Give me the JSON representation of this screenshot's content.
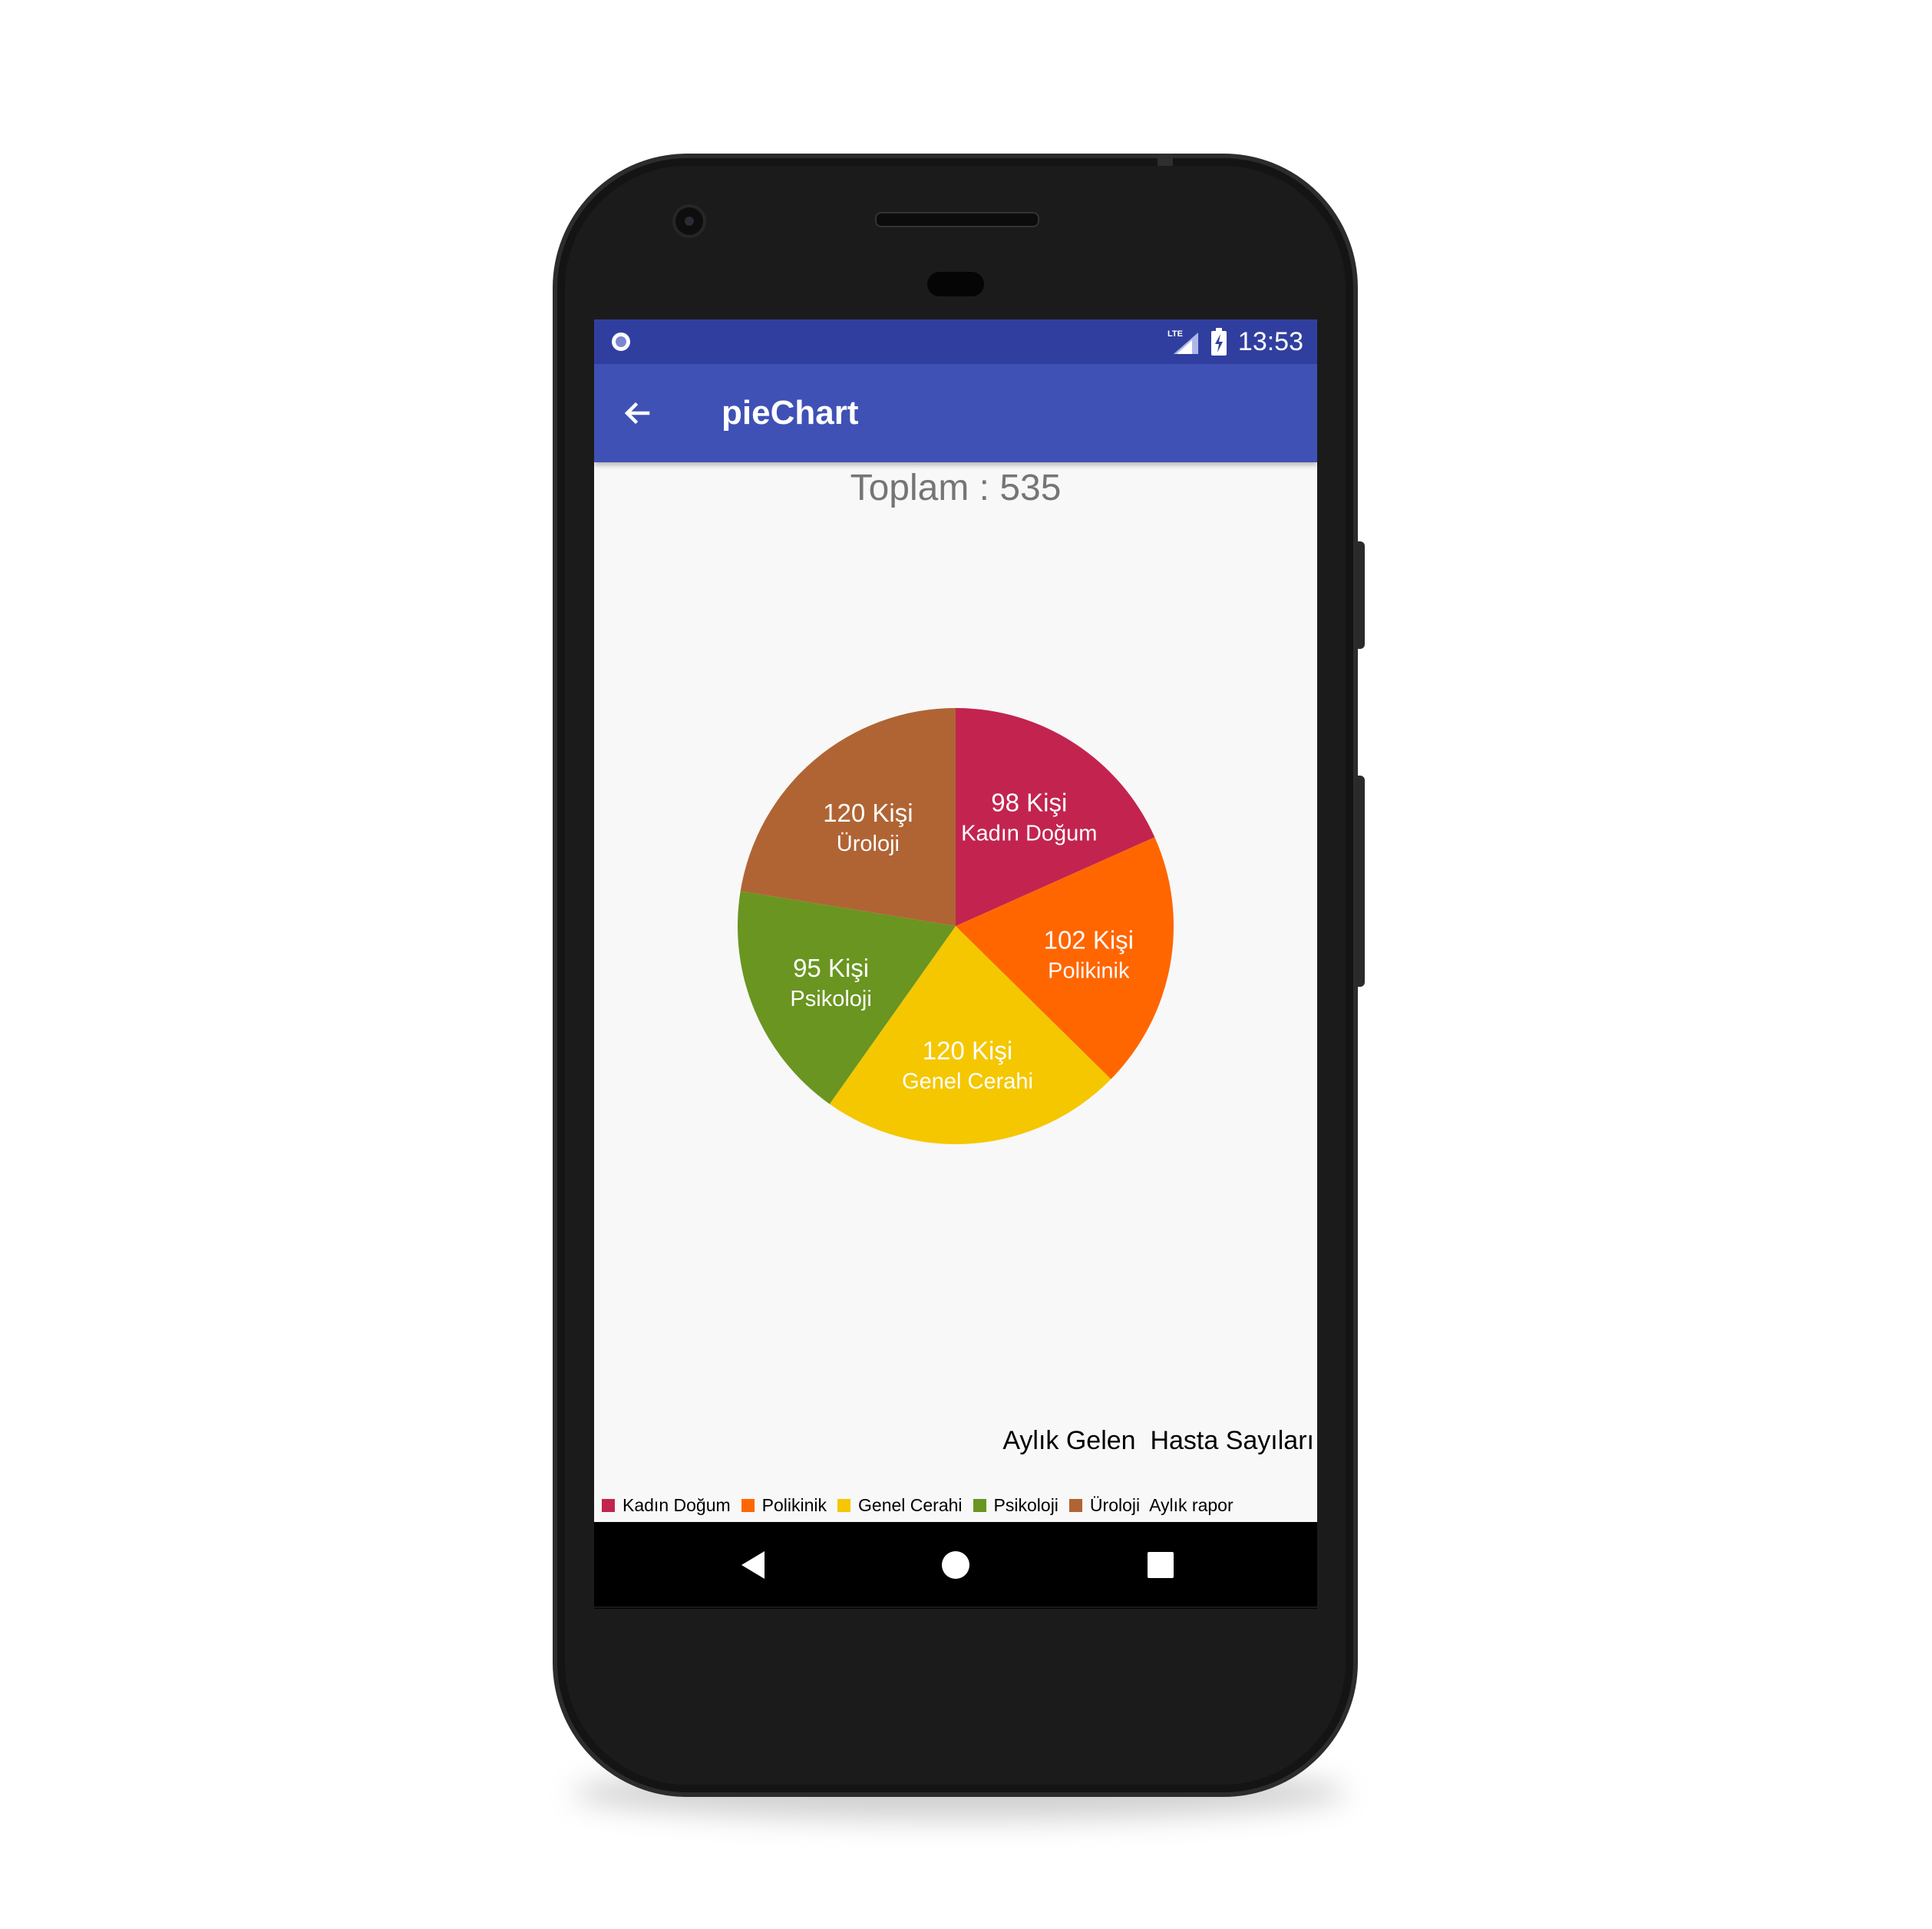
{
  "status_bar": {
    "time": "13:53",
    "network": "LTE",
    "icons": [
      "notification-ring-icon",
      "lte-signal-icon",
      "battery-charging-icon"
    ],
    "color": "#303f9f"
  },
  "app_bar": {
    "title": "pieChart",
    "back_icon": "arrow-back-icon",
    "color": "#3f51b5"
  },
  "nav_bar": {
    "icons": [
      "nav-back-icon",
      "nav-home-icon",
      "nav-recents-icon"
    ]
  },
  "chart_data": {
    "type": "pie",
    "title": "Toplam : 535",
    "description": "Aylık Gelen  Hasta Sayıları",
    "legend_caption": "Aylık rapor",
    "legend_placement": "bottom-left",
    "value_suffix": " Kişi",
    "slices": [
      {
        "label": "Kadın Doğum",
        "value": 98,
        "display": "98 Kişi",
        "color": "#c2244f"
      },
      {
        "label": "Polikinik",
        "value": 102,
        "display": "102 Kişi",
        "color": "#ff6600"
      },
      {
        "label": "Genel Cerahi",
        "value": 120,
        "display": "120 Kişi",
        "color": "#f4c700"
      },
      {
        "label": "Psikoloji",
        "value": 95,
        "display": "95 Kişi",
        "color": "#6a9520"
      },
      {
        "label": "Üroloji",
        "value": 120,
        "display": "120 Kişi",
        "color": "#b06434"
      }
    ]
  }
}
